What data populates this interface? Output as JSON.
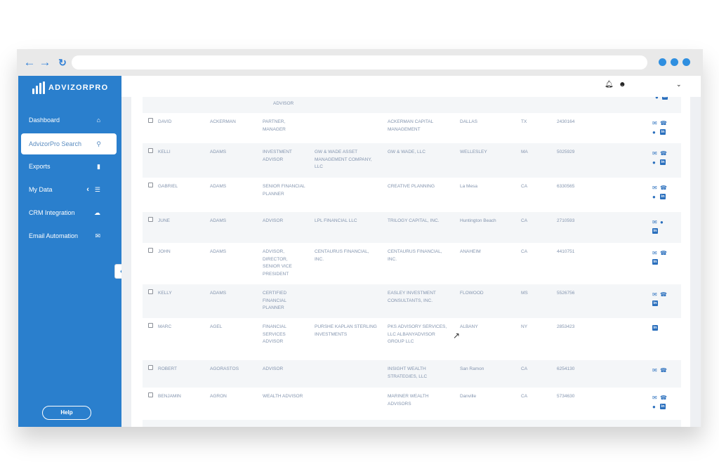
{
  "app": {
    "logo_text": "ADVIZORPRO"
  },
  "sidebar": {
    "items": [
      {
        "label": "Dashboard",
        "icon": "home-icon"
      },
      {
        "label": "AdvizorPro Search",
        "icon": "search-icon"
      },
      {
        "label": "Exports",
        "icon": "document-icon"
      },
      {
        "label": "My Data",
        "icon": "list-icon"
      },
      {
        "label": "CRM Integration",
        "icon": "cloud-icon"
      },
      {
        "label": "Email Automation",
        "icon": "envelope-icon"
      }
    ],
    "help_label": "Help"
  },
  "colors": {
    "sidebar_bg": "#2a7fcd",
    "accent": "#2f8fe0",
    "text_muted": "#8394ae",
    "icon_blue": "#2a6fbd"
  },
  "table": {
    "partial_top_title": "ADVISOR",
    "rows": [
      {
        "first": "DAVID",
        "last": "ACKERMAN",
        "title": "PARTNER, MANAGER",
        "bd_firm": "",
        "ria_firm": "ACKERMAN CAPITAL MANAGEMENT",
        "city": "DALLAS",
        "state": "TX",
        "crd": "2430164",
        "icons": [
          "mail",
          "phone",
          "person",
          "linkedin"
        ]
      },
      {
        "first": "KELLI",
        "last": "ADAMS",
        "title": "INVESTMENT ADVISOR",
        "bd_firm": "GW & WADE ASSET MANAGEMENT COMPANY, LLC",
        "ria_firm": "GW & WADE, LLC",
        "city": "WELLESLEY",
        "state": "MA",
        "crd": "5025929",
        "icons": [
          "mail",
          "phone",
          "person",
          "linkedin"
        ]
      },
      {
        "first": "GABRIEL",
        "last": "ADAMS",
        "title": "SENIOR FINANCIAL PLANNER",
        "bd_firm": "",
        "ria_firm": "CREATIVE PLANNING",
        "city": "La Mesa",
        "state": "CA",
        "crd": "6330565",
        "icons": [
          "mail",
          "phone",
          "person",
          "linkedin"
        ]
      },
      {
        "first": "JUNE",
        "last": "ADAMS",
        "title": "ADVISOR",
        "bd_firm": "LPL FINANCIAL LLC",
        "ria_firm": "TRILOGY CAPITAL, INC.",
        "city": "Huntington Beach",
        "state": "CA",
        "crd": "2710593",
        "icons": [
          "mail",
          "person",
          "linkedin"
        ]
      },
      {
        "first": "JOHN",
        "last": "ADAMS",
        "title": "ADVISOR, DIRECTOR, SENIOR VICE PRESIDENT",
        "bd_firm": "CENTAURUS FINANCIAL, INC.",
        "ria_firm": "CENTAURUS FINANCIAL, INC.",
        "city": "ANAHEIM",
        "state": "CA",
        "crd": "4410751",
        "icons": [
          "mail",
          "phone",
          "linkedin"
        ]
      },
      {
        "first": "KELLY",
        "last": "ADAMS",
        "title": "CERTIFIED FINANCIAL PLANNER",
        "bd_firm": "",
        "ria_firm": "EASLEY INVESTMENT CONSULTANTS, INC.",
        "city": "FLOWOOD",
        "state": "MS",
        "crd": "5526756",
        "icons": [
          "mail",
          "phone",
          "linkedin"
        ]
      },
      {
        "first": "MARC",
        "last": "AGEL",
        "title": "FINANCIAL SERVICES ADVISOR",
        "bd_firm": "PURSHE KAPLAN STERLING INVESTMENTS",
        "ria_firm": "PKS ADVISORY SERVICES, LLC ALBANYADVISOR GROUP LLC",
        "city": "ALBANY",
        "state": "NY",
        "crd": "2853423",
        "icons": [
          "linkedin"
        ]
      },
      {
        "first": "ROBERT",
        "last": "AGORASTOS",
        "title": "ADVISOR",
        "bd_firm": "",
        "ria_firm": "INSIGHT WEALTH STRATEGIES, LLC",
        "city": "San Ramon",
        "state": "CA",
        "crd": "6254130",
        "icons": [
          "mail",
          "phone"
        ]
      },
      {
        "first": "BENJAMIN",
        "last": "AGRON",
        "title": "WEALTH ADVISOR",
        "bd_firm": "",
        "ria_firm": "MARINER WEALTH ADVISORS",
        "city": "Danville",
        "state": "CA",
        "crd": "5734630",
        "icons": [
          "mail",
          "phone",
          "person",
          "linkedin"
        ]
      }
    ]
  }
}
